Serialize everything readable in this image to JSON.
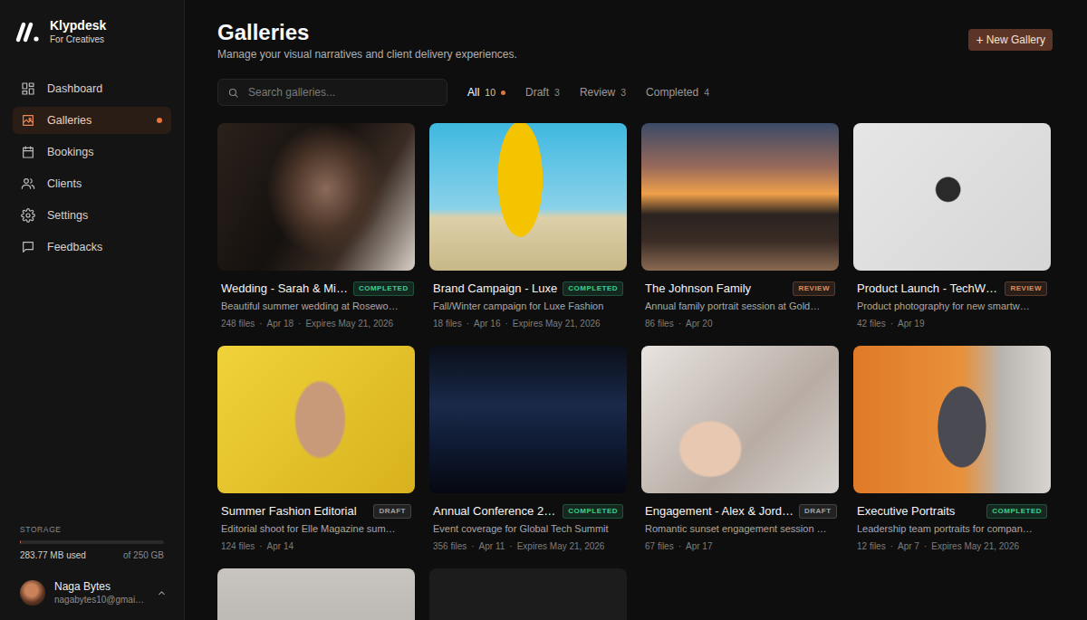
{
  "brand": {
    "name": "Klypdesk",
    "tagline": "For Creatives"
  },
  "sidebar": {
    "items": [
      {
        "label": "Dashboard",
        "selected": false,
        "notify": false
      },
      {
        "label": "Galleries",
        "selected": true,
        "notify": true
      },
      {
        "label": "Bookings",
        "selected": false,
        "notify": false
      },
      {
        "label": "Clients",
        "selected": false,
        "notify": false
      },
      {
        "label": "Settings",
        "selected": false,
        "notify": false
      },
      {
        "label": "Feedbacks",
        "selected": false,
        "notify": false
      }
    ]
  },
  "storage": {
    "label": "STORAGE",
    "used": "283.77 MB used",
    "total": "of 250 GB",
    "level": 0.0011
  },
  "user": {
    "name": "Naga Bytes",
    "email": "nagabytes10@gmai…"
  },
  "page": {
    "title": "Galleries",
    "subtitle": "Manage your visual narratives and client delivery experiences."
  },
  "new_button": {
    "icon": "+",
    "label": "New Gallery"
  },
  "search": {
    "placeholder": "Search galleries..."
  },
  "filters": [
    {
      "label": "All",
      "count": "10",
      "selected": true,
      "dot": true
    },
    {
      "label": "Draft",
      "count": "3",
      "selected": false,
      "dot": false
    },
    {
      "label": "Review",
      "count": "3",
      "selected": false,
      "dot": false
    },
    {
      "label": "Completed",
      "count": "4",
      "selected": false,
      "dot": false
    }
  ],
  "separator": "·",
  "galleries": [
    {
      "title": "Wedding - Sarah & Mi…",
      "badge": {
        "label": "COMPLETED",
        "color": "#3ecf8e"
      },
      "description": "Beautiful summer wedding at Rosewo…",
      "files": "248 files",
      "date": "Apr 18",
      "expires": "Expires May 21, 2026"
    },
    {
      "title": "Brand Campaign - Luxe",
      "badge": {
        "label": "COMPLETED",
        "color": "#3ecf8e"
      },
      "description": "Fall/Winter campaign for Luxe Fashion",
      "files": "18 files",
      "date": "Apr 16",
      "expires": "Expires May 21, 2026"
    },
    {
      "title": "The Johnson Family",
      "badge": {
        "label": "REVIEW",
        "color": "#e08a5a"
      },
      "description": "Annual family portrait session at Gold…",
      "files": "86 files",
      "date": "Apr 20"
    },
    {
      "title": "Product Launch - TechW…",
      "badge": {
        "label": "REVIEW",
        "color": "#e08a5a"
      },
      "description": "Product photography for new smartw…",
      "files": "42 files",
      "date": "Apr 19"
    },
    {
      "title": "Summer Fashion Editorial",
      "badge": {
        "label": "DRAFT",
        "color": "#a3a3a3"
      },
      "description": "Editorial shoot for Elle Magazine sum…",
      "files": "124 files",
      "date": "Apr 14"
    },
    {
      "title": "Annual Conference 2…",
      "badge": {
        "label": "COMPLETED",
        "color": "#3ecf8e"
      },
      "description": "Event coverage for Global Tech Summit",
      "files": "356 files",
      "date": "Apr 11",
      "expires": "Expires May 21, 2026"
    },
    {
      "title": "Engagement - Alex & Jord…",
      "badge": {
        "label": "DRAFT",
        "color": "#a3a3a3"
      },
      "description": "Romantic sunset engagement session …",
      "files": "67 files",
      "date": "Apr 17"
    },
    {
      "title": "Executive Portraits",
      "badge": {
        "label": "COMPLETED",
        "color": "#3ecf8e"
      },
      "description": "Leadership team portraits for compan…",
      "files": "12 files",
      "date": "Apr 7",
      "expires": "Expires May 21, 2026"
    }
  ],
  "more_cards": [
    {
      "kind": "photo"
    },
    {
      "kind": "empty"
    }
  ]
}
